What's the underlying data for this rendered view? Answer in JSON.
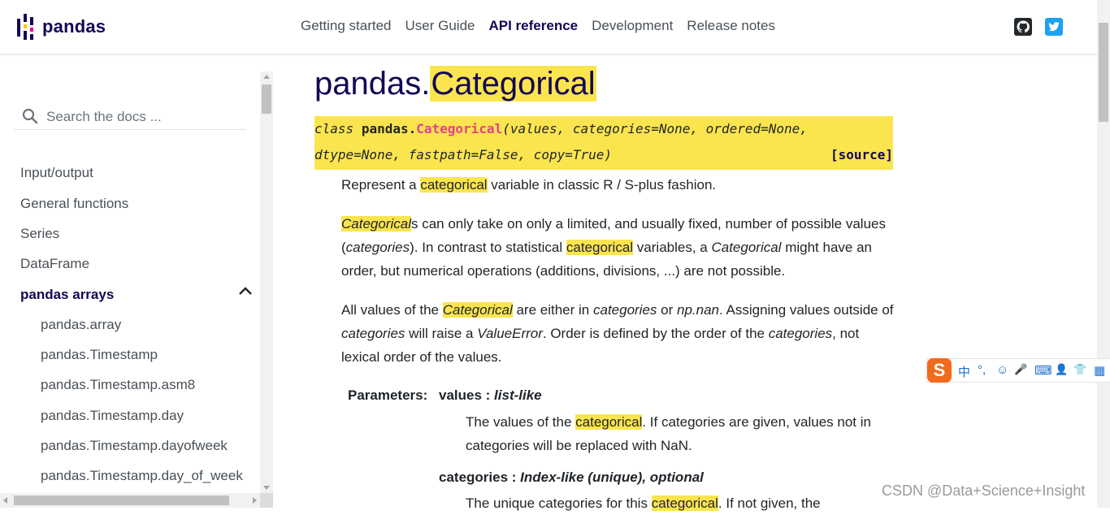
{
  "brand": {
    "name": "pandas"
  },
  "nav": {
    "items": [
      "Getting started",
      "User Guide",
      "API reference",
      "Development",
      "Release notes"
    ],
    "active": "API reference"
  },
  "social": {
    "github": "github-icon",
    "twitter": "twitter-icon"
  },
  "search": {
    "placeholder": "Search the docs ..."
  },
  "sidebar": {
    "items": [
      "Input/output",
      "General functions",
      "Series",
      "DataFrame",
      "pandas arrays"
    ],
    "active": "pandas arrays",
    "subitems": [
      "pandas.array",
      "pandas.Timestamp",
      "pandas.Timestamp.asm8",
      "pandas.Timestamp.day",
      "pandas.Timestamp.dayofweek",
      "pandas.Timestamp.day_of_week"
    ]
  },
  "doc": {
    "title_prefix": "pandas.",
    "title_highlight": "Categorical",
    "sig": {
      "keyword": "class",
      "module": "pandas.",
      "class_name": "Categorical",
      "line1_params": "(values, categories=None, ordered=None,",
      "line2_params": "dtype=None, fastpath=False, copy=True)",
      "source": "[source]"
    },
    "p1": {
      "a": "Represent a ",
      "hl": "categorical",
      "b": " variable in classic R / S-plus fashion."
    },
    "p2": {
      "hl": "Categorical",
      "a": "s can only take on only a limited, and usually fixed, number of possible values (",
      "it1": "categories",
      "b": "). In contrast to statistical ",
      "hl2": "categorical",
      "c": " variables, a ",
      "it2": "Categorical",
      "d": " might have an order, but numerical operations (additions, divisions, ...) are not possible."
    },
    "p3": {
      "a": "All values of the ",
      "hl": "Categorical",
      "b": " are either in ",
      "it1": "categories",
      "c": " or ",
      "it2": "np.nan",
      "d": ". Assigning values outside of ",
      "it3": "categories",
      "e": " will raise a ",
      "it4": "ValueError",
      "f": ". Order is defined by the order of the ",
      "it5": "categories",
      "g": ", not lexical order of the values."
    },
    "params_label": "Parameters:",
    "param1": {
      "name": "values",
      "sep": " : ",
      "type": "list-like",
      "desc_a": "The values of the ",
      "desc_hl": "categorical",
      "desc_b": ". If categories are given, values not in categories will be replaced with NaN."
    },
    "param2": {
      "name": "categories",
      "sep": " : ",
      "type": "Index-like (unique), optional",
      "desc_a": "The unique categories for this ",
      "desc_hl": "categorical",
      "desc_b": ". If not given, the"
    }
  },
  "ime": {
    "items": [
      "中",
      "°,",
      "☺",
      "🎤",
      "⌨",
      "👤",
      "👕",
      "▦"
    ]
  },
  "watermark": "CSDN @Data+Science+Insight"
}
